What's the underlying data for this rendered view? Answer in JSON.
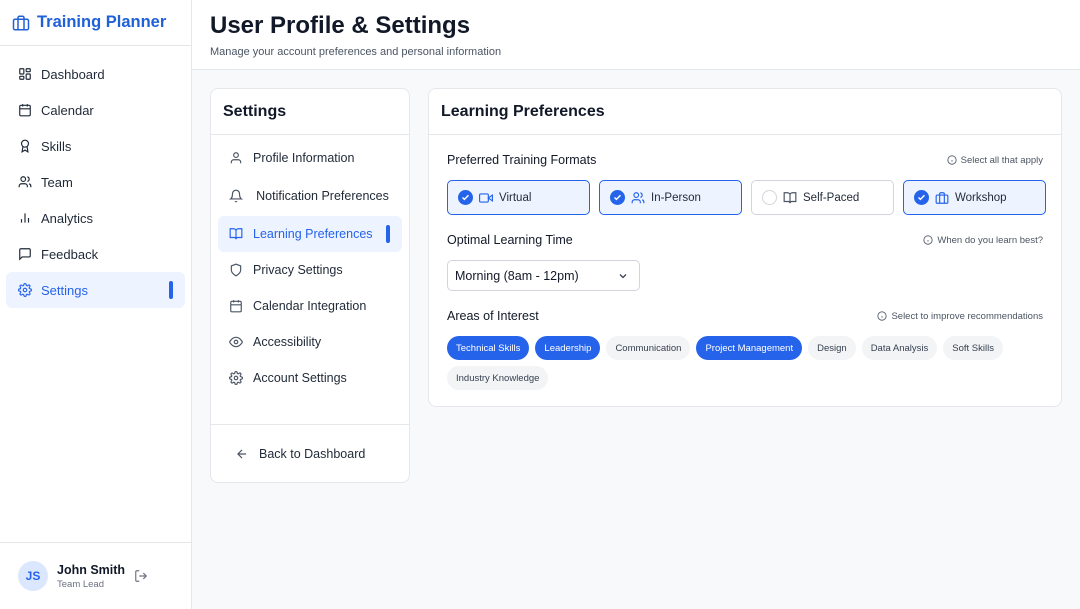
{
  "app": {
    "title": "Training Planner"
  },
  "sidebar": {
    "items": [
      {
        "label": "Dashboard",
        "icon": "grid-icon"
      },
      {
        "label": "Calendar",
        "icon": "calendar-icon"
      },
      {
        "label": "Skills",
        "icon": "award-icon"
      },
      {
        "label": "Team",
        "icon": "users-icon"
      },
      {
        "label": "Analytics",
        "icon": "bar-chart-icon"
      },
      {
        "label": "Feedback",
        "icon": "message-icon"
      },
      {
        "label": "Settings",
        "icon": "gear-icon",
        "active": true
      }
    ]
  },
  "user": {
    "initials": "JS",
    "name": "John Smith",
    "role": "Team Lead"
  },
  "header": {
    "title": "User Profile & Settings",
    "subtitle": "Manage your account preferences and personal information"
  },
  "settings": {
    "title": "Settings",
    "items": [
      {
        "label": "Profile Information",
        "icon": "user-icon"
      },
      {
        "label": "Notification Preferences",
        "icon": "bell-icon"
      },
      {
        "label": "Learning Preferences",
        "icon": "book-icon",
        "active": true
      },
      {
        "label": "Privacy Settings",
        "icon": "shield-icon"
      },
      {
        "label": "Calendar Integration",
        "icon": "calendar-icon"
      },
      {
        "label": "Accessibility",
        "icon": "eye-icon"
      },
      {
        "label": "Account Settings",
        "icon": "gear-icon"
      }
    ],
    "back_label": "Back to Dashboard"
  },
  "learning": {
    "title": "Learning Preferences",
    "formats": {
      "label": "Preferred Training Formats",
      "hint": "Select all that apply",
      "options": [
        {
          "label": "Virtual",
          "selected": true,
          "icon": "video-icon"
        },
        {
          "label": "In-Person",
          "selected": true,
          "icon": "users-icon"
        },
        {
          "label": "Self-Paced",
          "selected": false,
          "icon": "book-icon"
        },
        {
          "label": "Workshop",
          "selected": true,
          "icon": "briefcase-icon"
        }
      ]
    },
    "time": {
      "label": "Optimal Learning Time",
      "hint": "When do you learn best?",
      "selected": "Morning (8am - 12pm)"
    },
    "interests": {
      "label": "Areas of Interest",
      "hint": "Select to improve recommendations",
      "chips": [
        {
          "label": "Technical Skills",
          "selected": true
        },
        {
          "label": "Leadership",
          "selected": true
        },
        {
          "label": "Communication",
          "selected": false
        },
        {
          "label": "Project Management",
          "selected": true
        },
        {
          "label": "Design",
          "selected": false
        },
        {
          "label": "Data Analysis",
          "selected": false
        },
        {
          "label": "Soft Skills",
          "selected": false
        },
        {
          "label": "Industry Knowledge",
          "selected": false
        }
      ]
    }
  },
  "colors": {
    "accent": "#2563eb",
    "brand": "#2060d8",
    "active_bg": "#eef4ff"
  }
}
